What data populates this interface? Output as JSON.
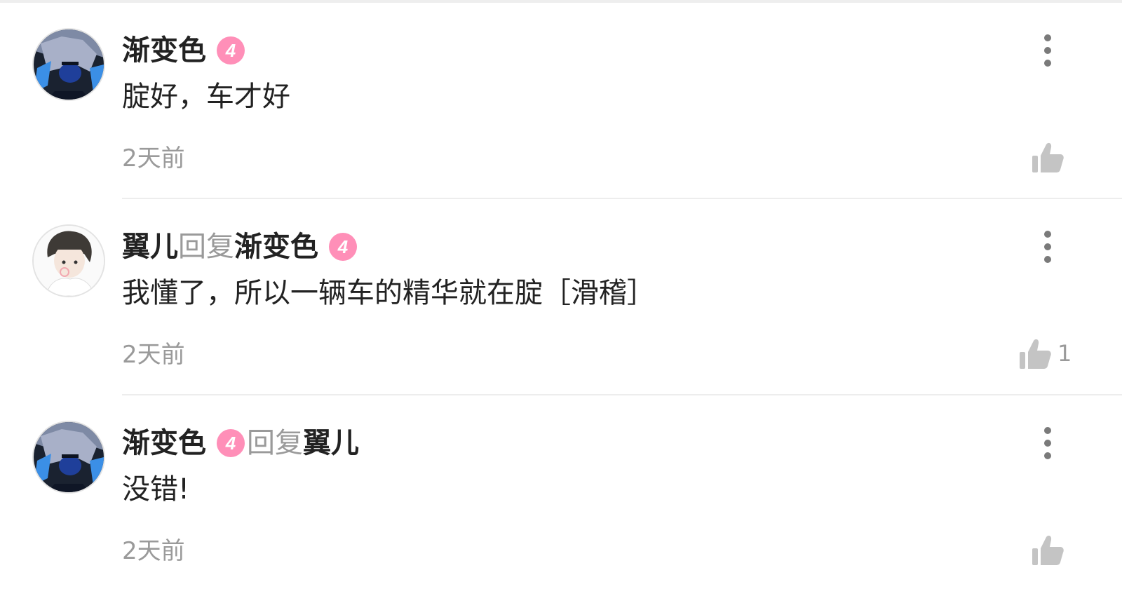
{
  "comments": [
    {
      "author": "渐变色",
      "level": "4",
      "reply_word": "",
      "reply_to": "",
      "text": "腚好，车才好",
      "time": "2天前",
      "likes": ""
    },
    {
      "author": "翼儿",
      "level": "",
      "reply_word": "回复",
      "reply_to": "渐变色",
      "reply_to_level": "4",
      "text": "我懂了，所以一辆车的精华就在腚［滑稽］",
      "time": "2天前",
      "likes": "1"
    },
    {
      "author": "渐变色",
      "level": "4",
      "reply_word": "回复",
      "reply_to": "翼儿",
      "text": "没错!",
      "time": "2天前",
      "likes": ""
    }
  ],
  "icons": {
    "more": "more-vertical-icon",
    "like": "thumbs-up-icon",
    "level": "level-badge-icon"
  },
  "colors": {
    "badge_pink": "#ff8fb8",
    "icon_gray": "#c4c4c4",
    "secondary_text": "#9a9a9a",
    "primary_text": "#222222"
  }
}
